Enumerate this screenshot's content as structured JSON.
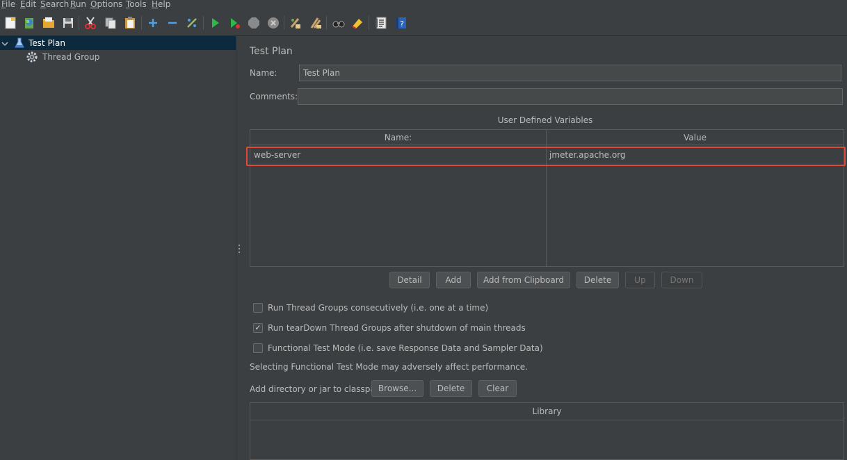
{
  "menu": {
    "items": [
      {
        "label": "File",
        "mnemonic": "F",
        "rest": "ile"
      },
      {
        "label": "Edit",
        "mnemonic": "E",
        "rest": "dit"
      },
      {
        "label": "Search",
        "mnemonic": "S",
        "rest": "earch"
      },
      {
        "label": "Run",
        "mnemonic": "R",
        "rest": "un"
      },
      {
        "label": "Options",
        "mnemonic": "O",
        "rest": "ptions"
      },
      {
        "label": "Tools",
        "mnemonic": "T",
        "rest": "ools"
      },
      {
        "label": "Help",
        "mnemonic": "H",
        "rest": "elp"
      }
    ]
  },
  "toolbar": {
    "icons": [
      "new-icon",
      "templates-icon",
      "open-icon",
      "save-icon",
      "cut-icon",
      "copy-icon",
      "paste-icon",
      "expand-icon",
      "collapse-icon",
      "toggle-icon",
      "start-icon",
      "start-no-pauses-icon",
      "stop-icon",
      "shutdown-icon",
      "clear-icon",
      "clear-all-icon",
      "search-icon",
      "reset-search-icon",
      "function-helper-icon",
      "help-icon"
    ]
  },
  "tree": {
    "items": [
      {
        "label": "Test Plan",
        "icon": "test-plan-icon",
        "selected": true
      },
      {
        "label": "Thread Group",
        "icon": "gear-icon",
        "selected": false
      }
    ]
  },
  "panel": {
    "title": "Test Plan",
    "name_label": "Name:",
    "name_value": "Test Plan",
    "comments_label": "Comments:",
    "comments_value": "",
    "udv_title": "User Defined Variables",
    "table": {
      "columns": [
        "Name:",
        "Value"
      ],
      "rows": [
        {
          "name": "web-server",
          "value": "jmeter.apache.org"
        }
      ]
    },
    "buttons": {
      "detail": "Detail",
      "add": "Add",
      "add_clipboard": "Add from Clipboard",
      "delete": "Delete",
      "up": "Up",
      "down": "Down"
    },
    "checkboxes": [
      {
        "label": "Run Thread Groups consecutively (i.e. one at a time)",
        "checked": false
      },
      {
        "label": "Run tearDown Thread Groups after shutdown of main threads",
        "checked": true
      },
      {
        "label": "Functional Test Mode (i.e. save Response Data and Sampler Data)",
        "checked": false
      }
    ],
    "functional_note": "Selecting Functional Test Mode may adversely affect performance.",
    "classpath_label": "Add directory or jar to classpath",
    "classpath_buttons": {
      "browse": "Browse...",
      "delete": "Delete",
      "clear": "Clear"
    },
    "library_header": "Library"
  },
  "colors": {
    "background": "#3c3f41",
    "selection": "#0d293e",
    "highlight": "#e0493b"
  }
}
